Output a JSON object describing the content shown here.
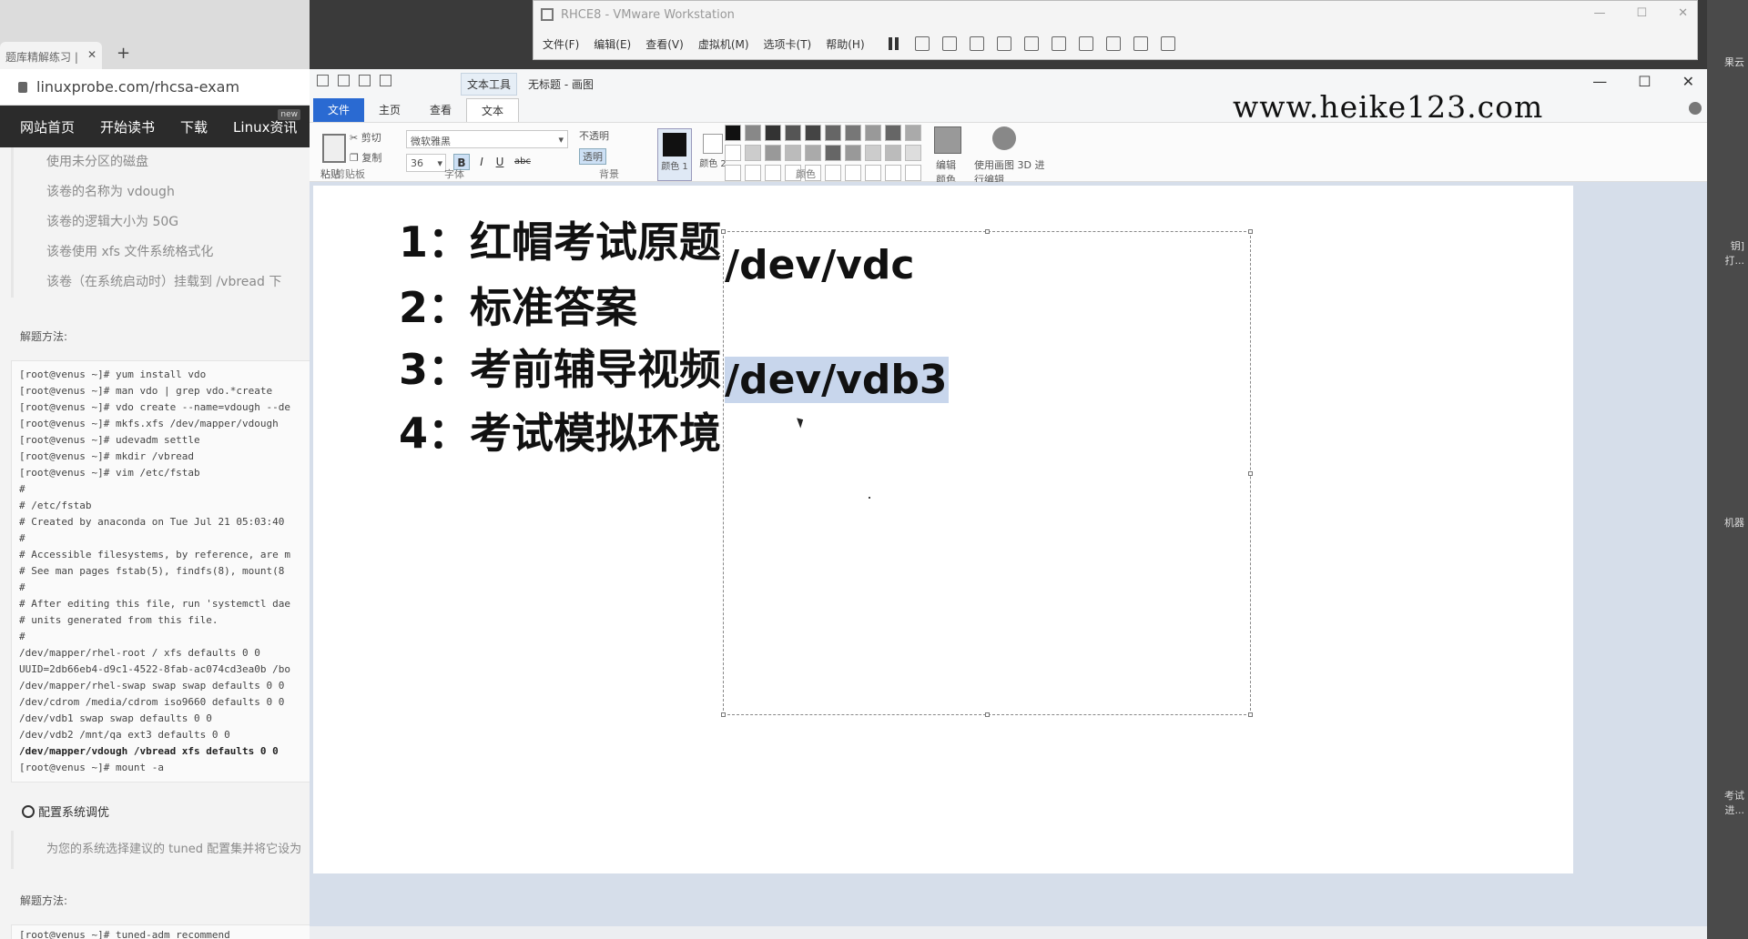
{
  "browser": {
    "tab_title": "题库精解练习 |",
    "url": "linuxprobe.com/rhcsa-exam",
    "nav": [
      "网站首页",
      "开始读书",
      "下载",
      "Linux资讯"
    ],
    "nav_badge": "new",
    "requirements": [
      "使用未分区的磁盘",
      "该卷的名称为 vdough",
      "该卷的逻辑大小为 50G",
      "该卷使用 xfs 文件系统格式化",
      "该卷（在系统启动时）挂载到 /vbread 下"
    ],
    "solution_label_1": "解题方法:",
    "terminal_lines": [
      "[root@venus ~]# yum install vdo",
      "[root@venus ~]# man vdo | grep vdo.*create",
      "[root@venus ~]# vdo create --name=vdough --de",
      "[root@venus ~]# mkfs.xfs /dev/mapper/vdough",
      "[root@venus ~]# udevadm settle",
      "[root@venus ~]# mkdir /vbread",
      "[root@venus ~]# vim /etc/fstab",
      "#",
      "# /etc/fstab",
      "# Created by anaconda on Tue Jul 21 05:03:40",
      "#",
      "# Accessible filesystems, by reference, are m",
      "# See man pages fstab(5), findfs(8), mount(8",
      "#",
      "# After editing this file, run 'systemctl dae",
      "# units generated from this file.",
      "#",
      "/dev/mapper/rhel-root / xfs defaults 0 0",
      "UUID=2db66eb4-d9c1-4522-8fab-ac074cd3ea0b /bo",
      "/dev/mapper/rhel-swap swap swap defaults 0 0",
      "/dev/cdrom /media/cdrom iso9660 defaults 0 0",
      "/dev/vdb1 swap swap defaults 0 0",
      "/dev/vdb2 /mnt/qa ext3 defaults 0 0"
    ],
    "terminal_bold_line": "/dev/mapper/vdough /vbread xfs defaults 0 0",
    "terminal_last_line": "[root@venus ~]# mount -a",
    "subsection_title": "配置系统调优",
    "subsection_note": "为您的系统选择建议的 tuned 配置集并将它设为",
    "solution_label_2": "解题方法:",
    "terminal2_line": "[root@venus ~]# tuned-adm recommend"
  },
  "vmware": {
    "title": "RHCE8 - VMware Workstation",
    "menus": [
      "文件(F)",
      "编辑(E)",
      "查看(V)",
      "虚拟机(M)",
      "选项卡(T)",
      "帮助(H)"
    ]
  },
  "paint": {
    "context_tab": "文本工具",
    "title": "无标题 - 画图",
    "watermark": "www.heike123.com",
    "tabs": [
      "文件",
      "主页",
      "查看",
      "文本"
    ],
    "ribbon": {
      "paste": "粘贴",
      "cut": "剪切",
      "copy": "复制",
      "clipboard_group": "剪贴板",
      "font_name": "微软雅黑",
      "font_size": "36",
      "bold": "B",
      "italic": "I",
      "underline": "U",
      "strike": "abc",
      "font_group": "字体",
      "opaque": "不透明",
      "transparent": "透明",
      "background_group": "背景",
      "color1": "颜色 1",
      "color2": "颜色 2",
      "edit_colors": "编辑颜色",
      "paint3d": "使用画图 3D 进行编辑",
      "colors_group": "颜色"
    },
    "canvas": {
      "items": [
        "1：红帽考试原题",
        "2：标准答案",
        "3：考前辅导视频",
        "4：考试模拟环境"
      ],
      "text_line_1": "/dev/vdc",
      "text_line_2": "/dev/vdb3"
    }
  },
  "right_strip": [
    "果云",
    "钥]",
    "打...",
    "机器",
    "考试",
    "进..."
  ],
  "colors": {
    "accent": "#2a6ad2",
    "selection": "#c8d6ec",
    "site_nav_bg": "#2b2b2b"
  }
}
